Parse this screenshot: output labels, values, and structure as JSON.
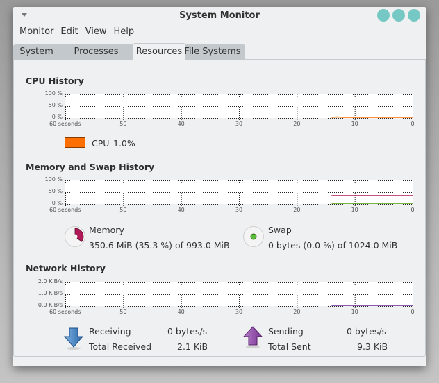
{
  "window": {
    "title": "System Monitor",
    "window_button_color": "#76c8c4"
  },
  "menu": [
    "Monitor",
    "Edit",
    "View",
    "Help"
  ],
  "tabs": [
    {
      "label": "System",
      "active": false
    },
    {
      "label": "Processes",
      "active": false
    },
    {
      "label": "Resources",
      "active": true
    },
    {
      "label": "File Systems",
      "active": false
    }
  ],
  "x_ticks": [
    "60 seconds",
    "50",
    "40",
    "30",
    "20",
    "10",
    "0"
  ],
  "cpu": {
    "title": "CPU History",
    "y_ticks": [
      "100 %",
      "50 %",
      "0 %"
    ],
    "legend_label": "CPU",
    "legend_value": "1.0%",
    "color": "#ff6f00"
  },
  "memory": {
    "title": "Memory and Swap History",
    "y_ticks": [
      "100 %",
      "50 %",
      "0 %"
    ],
    "mem_label": "Memory",
    "mem_value": "350.6 MiB (35.3 %) of 993.0 MiB",
    "mem_percent": 35.3,
    "mem_color": "#b01a59",
    "swap_label": "Swap",
    "swap_value": "0 bytes (0.0 %) of 1024.0 MiB",
    "swap_percent": 0.0,
    "swap_color": "#4e9a06"
  },
  "network": {
    "title": "Network History",
    "y_ticks": [
      "2.0 KiB/s",
      "1.0 KiB/s",
      "0.0 KiB/s"
    ],
    "receiving_label": "Receiving",
    "receiving_value": "0 bytes/s",
    "total_received_label": "Total Received",
    "total_received_value": "2.1 KiB",
    "sending_label": "Sending",
    "sending_value": "0 bytes/s",
    "total_sent_label": "Total Sent",
    "total_sent_value": "9.3 KiB",
    "recv_color": "#3a7dc4",
    "send_color": "#8a3a9e"
  },
  "chart_data": [
    {
      "type": "line",
      "title": "CPU History",
      "xlabel": "",
      "ylabel": "",
      "x": [
        14,
        13,
        12,
        11,
        10,
        9,
        8,
        7,
        6,
        5,
        4,
        3,
        2,
        1,
        0
      ],
      "xlim": [
        60,
        0
      ],
      "ylim": [
        0,
        100
      ],
      "x_tick_labels": [
        "60 seconds",
        "50",
        "40",
        "30",
        "20",
        "10",
        "0"
      ],
      "y_tick_labels": [
        "100 %",
        "50 %",
        "0 %"
      ],
      "series": [
        {
          "name": "CPU",
          "values": [
            1.0,
            4.5,
            3.0,
            2.5,
            2.0,
            2.0,
            2.0,
            2.5,
            1.5,
            1.5,
            1.5,
            1.0,
            1.0,
            1.0,
            1.0
          ]
        }
      ],
      "grid": true
    },
    {
      "type": "line",
      "title": "Memory and Swap History",
      "x": [
        14,
        0
      ],
      "xlim": [
        60,
        0
      ],
      "ylim": [
        0,
        100
      ],
      "x_tick_labels": [
        "60 seconds",
        "50",
        "40",
        "30",
        "20",
        "10",
        "0"
      ],
      "y_tick_labels": [
        "100 %",
        "50 %",
        "0 %"
      ],
      "series": [
        {
          "name": "Memory",
          "values": [
            35.3,
            35.3
          ]
        },
        {
          "name": "Swap",
          "values": [
            0.0,
            0.0
          ]
        }
      ],
      "grid": true
    },
    {
      "type": "line",
      "title": "Network History",
      "x": [
        14,
        0
      ],
      "xlim": [
        60,
        0
      ],
      "ylim": [
        0,
        2.0
      ],
      "x_tick_labels": [
        "60 seconds",
        "50",
        "40",
        "30",
        "20",
        "10",
        "0"
      ],
      "y_tick_labels": [
        "2.0 KiB/s",
        "1.0 KiB/s",
        "0.0 KiB/s"
      ],
      "series": [
        {
          "name": "Receiving",
          "values": [
            0.0,
            0.0
          ]
        },
        {
          "name": "Sending",
          "values": [
            0.0,
            0.0
          ]
        }
      ],
      "grid": true
    }
  ]
}
